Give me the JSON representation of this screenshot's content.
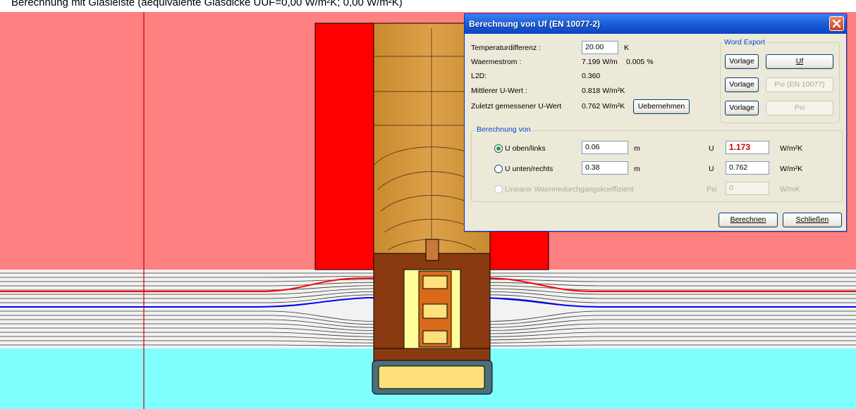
{
  "caption": {
    "text": "Berechnung mit Glasleiste (aequivalente Glasdicke UUF=0,00 W/m²K; 0,00 W/m²K)"
  },
  "dialog": {
    "title": "Berechnung von Uf (EN 10077-2)",
    "rows": [
      {
        "label": "Temperaturdifferenz :",
        "value": "20.00",
        "unit": "K"
      },
      {
        "label": "Waermestrom :",
        "value": "7.199 W/m",
        "extra": "0.005 %"
      },
      {
        "label": "L2D:",
        "value": "0.360"
      },
      {
        "label": "Mittlerer U-Wert :",
        "value": "0.818 W/m²K"
      },
      {
        "label": "Zuletzt gemessener U-Wert",
        "value": "0.762 W/m²K"
      }
    ],
    "uebernehmen_label": "Uebernehmen",
    "word_export": {
      "title": "Word Export",
      "vorlage_label": "Vorlage",
      "uf_label": "Uf",
      "psi_en_label": "Psi (EN 10077)",
      "psi_label": "Psi"
    },
    "berechnung_von": {
      "title": "Berechnung von",
      "options": [
        {
          "label": "U oben/links",
          "length": "0.06",
          "length_unit": "m",
          "u_prefix": "U",
          "u_value": "1.173",
          "u_unit": "W/m²K",
          "selected": true
        },
        {
          "label": "U unten/rechts",
          "length": "0.38",
          "length_unit": "m",
          "u_prefix": "U",
          "u_value": "0.762",
          "u_unit": "W/m²K",
          "selected": false
        },
        {
          "label": "Linearer Waermedurchgangskoeffizient",
          "psi_prefix": "Psi",
          "psi_value": "0",
          "psi_unit": "W/mK",
          "disabled": true
        }
      ]
    },
    "berechnen_label": "Berechnen",
    "schliessen_label": "Schließen"
  },
  "colors": {
    "warm_background": "#ff8080",
    "cold_background": "#80ffff",
    "wall": "#ff0000",
    "frame_wood": "#d99a3c",
    "isotherm_hot": "#ff0000",
    "isotherm_cold": "#0000ff",
    "dialog_face": "#ece9d8",
    "titlebar": "#1f5fd8",
    "accent_value": "#cc0000"
  }
}
